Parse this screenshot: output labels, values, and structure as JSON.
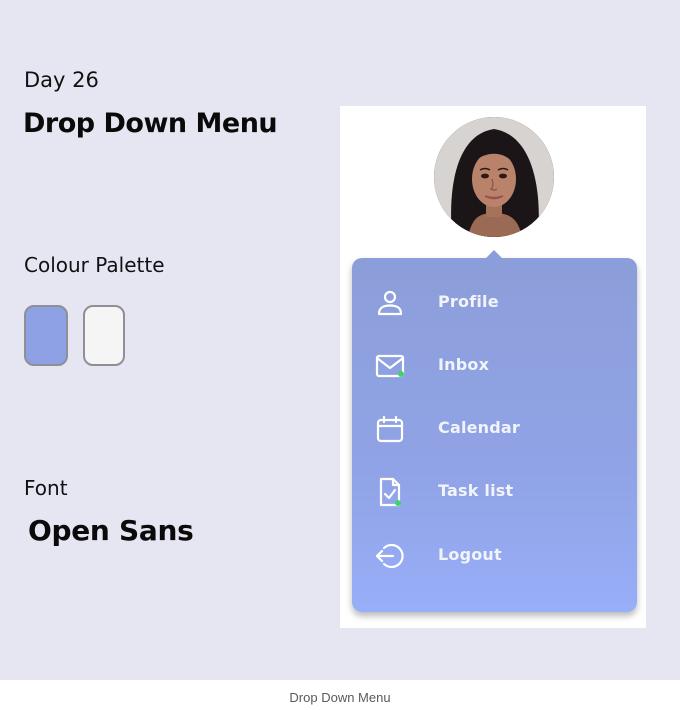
{
  "header": {
    "day": "Day 26",
    "title": "Drop Down Menu"
  },
  "palette": {
    "label": "Colour Palette",
    "colors": [
      "#8ea1e4",
      "#f5f5f5"
    ]
  },
  "font_section": {
    "label": "Font",
    "name": "Open Sans"
  },
  "menu": {
    "items": [
      {
        "label": "Profile",
        "icon": "user-icon",
        "badge": false
      },
      {
        "label": "Inbox",
        "icon": "mail-icon",
        "badge": true
      },
      {
        "label": "Calendar",
        "icon": "calendar-icon",
        "badge": false
      },
      {
        "label": "Task list",
        "icon": "task-list-icon",
        "badge": true
      },
      {
        "label": "Logout",
        "icon": "logout-icon",
        "badge": false
      }
    ],
    "badge_color": "#3fd36a"
  },
  "footer": {
    "caption": "Drop Down Menu"
  }
}
